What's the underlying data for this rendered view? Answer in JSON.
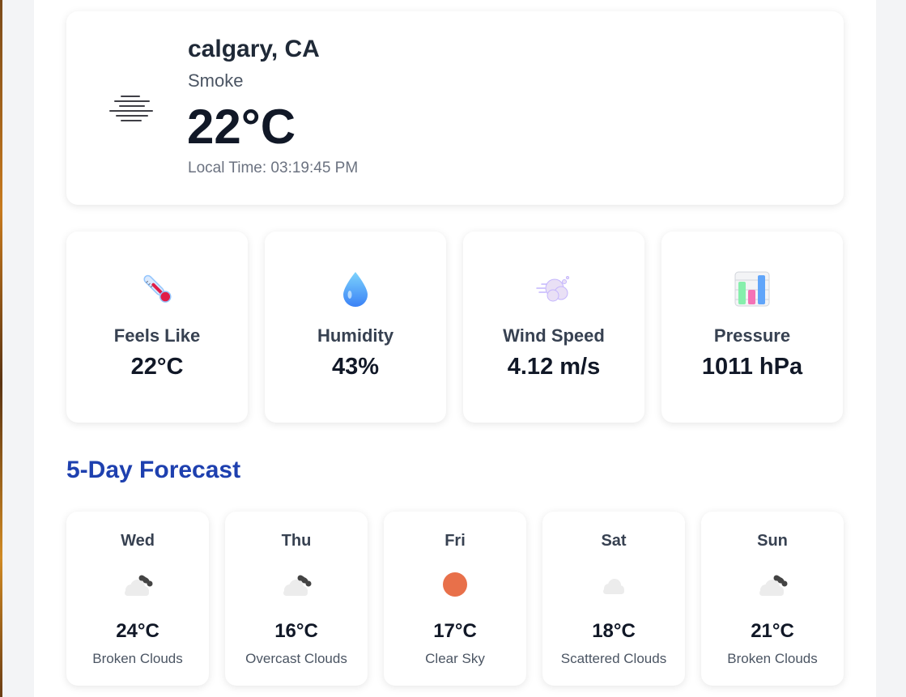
{
  "current": {
    "city": "calgary, CA",
    "condition": "Smoke",
    "temperature": "22°C",
    "local_time": "Local Time: 03:19:45 PM",
    "icon": "smoke-haze-icon"
  },
  "stats": [
    {
      "label": "Feels Like",
      "value": "22°C",
      "icon": "thermometer-icon"
    },
    {
      "label": "Humidity",
      "value": "43%",
      "icon": "droplet-icon"
    },
    {
      "label": "Wind Speed",
      "value": "4.12 m/s",
      "icon": "wind-icon"
    },
    {
      "label": "Pressure",
      "value": "1011 hPa",
      "icon": "bar-chart-icon"
    }
  ],
  "forecast": {
    "title": "5-Day Forecast",
    "days": [
      {
        "day": "Wed",
        "temp": "24°C",
        "desc": "Broken Clouds",
        "icon": "broken-clouds-icon"
      },
      {
        "day": "Thu",
        "temp": "16°C",
        "desc": "Overcast Clouds",
        "icon": "overcast-clouds-icon"
      },
      {
        "day": "Fri",
        "temp": "17°C",
        "desc": "Clear Sky",
        "icon": "clear-sky-sun-icon"
      },
      {
        "day": "Sat",
        "temp": "18°C",
        "desc": "Scattered Clouds",
        "icon": "scattered-clouds-icon"
      },
      {
        "day": "Sun",
        "temp": "21°C",
        "desc": "Broken Clouds",
        "icon": "broken-clouds-icon"
      }
    ]
  },
  "colors": {
    "accent": "#1e40af",
    "sun": "#e8704a"
  }
}
